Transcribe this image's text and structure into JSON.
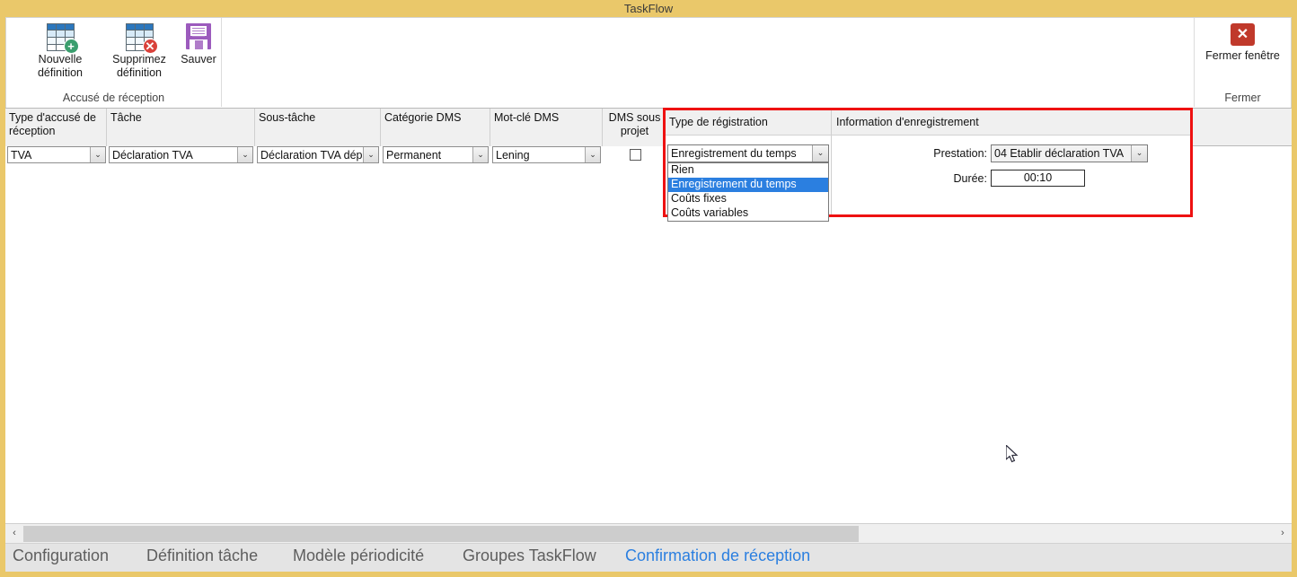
{
  "window": {
    "title": "TaskFlow",
    "accent_yellow": "#eac86a",
    "highlight_blue": "#2b7fe0",
    "alert_red": "#ee1111"
  },
  "ribbon": {
    "groups": [
      {
        "label": "Accusé de réception"
      },
      {
        "label": "Fermer"
      }
    ],
    "buttons": {
      "new_definition": {
        "line1": "Nouvelle",
        "line2": "définition",
        "icon": "table-add-icon"
      },
      "delete_definition": {
        "line1": "Supprimez",
        "line2": "définition",
        "icon": "table-delete-icon"
      },
      "save": {
        "line1": "Sauver",
        "line2": "",
        "icon": "floppy-save-icon"
      },
      "close_window": {
        "line1": "Fermer fenêtre",
        "line2": "",
        "icon": "close-x-icon"
      }
    }
  },
  "grid": {
    "columns": [
      {
        "label": "Type d'accusé de réception",
        "align": "left"
      },
      {
        "label": "Tâche",
        "align": "left"
      },
      {
        "label": "Sous-tâche",
        "align": "left"
      },
      {
        "label": "Catégorie DMS",
        "align": "left"
      },
      {
        "label": "Mot-clé DMS",
        "align": "left"
      },
      {
        "label": "DMS sous projet",
        "align": "center"
      }
    ],
    "rows": [
      {
        "type_accuse": "TVA",
        "tache": "Déclaration TVA",
        "sous_tache": "Déclaration TVA dépo",
        "categorie_dms": "Permanent",
        "mot_cle_dms": "Lening",
        "dms_sous_projet": false
      }
    ]
  },
  "registration_panel": {
    "header_type": "Type de régistration",
    "header_info": "Information d'enregistrement",
    "type_selected": "Enregistrement du temps",
    "type_options": [
      {
        "label": "Rien",
        "selected": false
      },
      {
        "label": "Enregistrement du temps",
        "selected": true
      },
      {
        "label": "Coûts fixes",
        "selected": false
      },
      {
        "label": "Coûts variables",
        "selected": false
      }
    ],
    "prestation_label": "Prestation:",
    "prestation_value": "04 Etablir déclaration TVA",
    "duree_label": "Durée:",
    "duree_value": "00:10"
  },
  "scrollbar": {
    "left_arrow": "‹",
    "right_arrow": "›"
  },
  "tabs": [
    {
      "label": "Configuration",
      "active": false
    },
    {
      "label": "Définition tâche",
      "active": false
    },
    {
      "label": "Modèle périodicité",
      "active": false
    },
    {
      "label": "Groupes TaskFlow",
      "active": false
    },
    {
      "label": "Confirmation de réception",
      "active": true
    }
  ]
}
